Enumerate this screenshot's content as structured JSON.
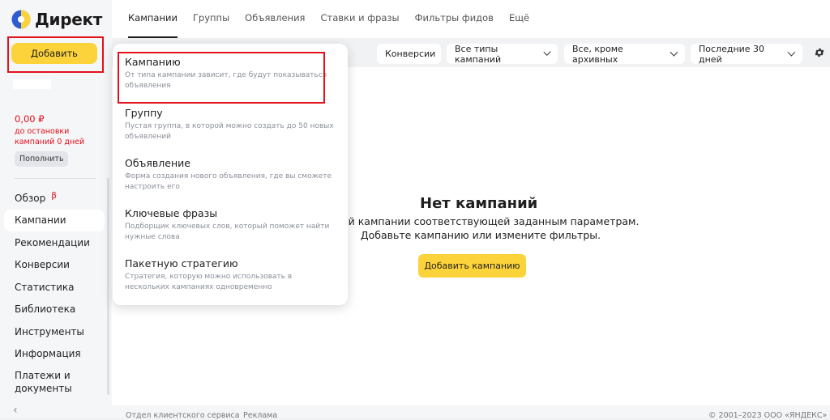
{
  "sidebar": {
    "logo_text": "Директ",
    "add_button": "Добавить",
    "balance": {
      "amount": "0,00 ₽",
      "note": "до остановки кампаний 0 дней",
      "topup_button": "Пополнить"
    },
    "nav": [
      {
        "label": "Обзор",
        "badge": "β"
      },
      {
        "label": "Кампании"
      },
      {
        "label": "Рекомендации"
      },
      {
        "label": "Конверсии"
      },
      {
        "label": "Статистика"
      },
      {
        "label": "Библиотека"
      },
      {
        "label": "Инструменты"
      },
      {
        "label": "Информация"
      },
      {
        "label": "Платежи и документы"
      }
    ],
    "collapse_glyph": "‹"
  },
  "header": {
    "tabs": [
      "Кампании",
      "Группы",
      "Объявления",
      "Ставки и фразы",
      "Фильтры фидов",
      "Ещё"
    ],
    "active_tab": "Кампании"
  },
  "toolbar": {
    "conversions": "Конверсии",
    "campaign_types": "Все типы кампаний",
    "archive_filter": "Все, кроме архивных",
    "period": "Последние 30 дней"
  },
  "main": {
    "empty_title": "Нет кампаний",
    "empty_line1": "одной кампании соответствующей заданным параметрам.",
    "empty_line2": "Добавьте кампанию или измените фильтры.",
    "add_campaign_button": "Добавить кампанию"
  },
  "dropdown": {
    "items": [
      {
        "title": "Кампанию",
        "desc": "От типа кампании зависит, где будут показываться объявления"
      },
      {
        "title": "Группу",
        "desc": "Пустая группа, в которой можно создать до 50 новых объявлений"
      },
      {
        "title": "Объявление",
        "desc": "Форма создания нового объявления, где вы сможете настроить его"
      },
      {
        "title": "Ключевые фразы",
        "desc": "Подборщик ключевых слов, который поможет найти нужные слова"
      },
      {
        "title": "Пакетную стратегию",
        "desc": "Стратегия, которую можно использовать в нескольких кампаниях одновременно"
      }
    ]
  },
  "footer": {
    "support": "Отдел клиентского сервиса",
    "ads": "Реклама",
    "copyright": "© 2001–2023 ООО «ЯНДЕКС»"
  },
  "colors": {
    "accent_yellow": "#fcd33a",
    "highlight_red": "#e3111b",
    "logo_blue": "#2f5bd3"
  },
  "icons": [
    "yandex-direct-logo-icon",
    "chevron-down-icon",
    "gear-icon",
    "chevron-left-icon"
  ]
}
